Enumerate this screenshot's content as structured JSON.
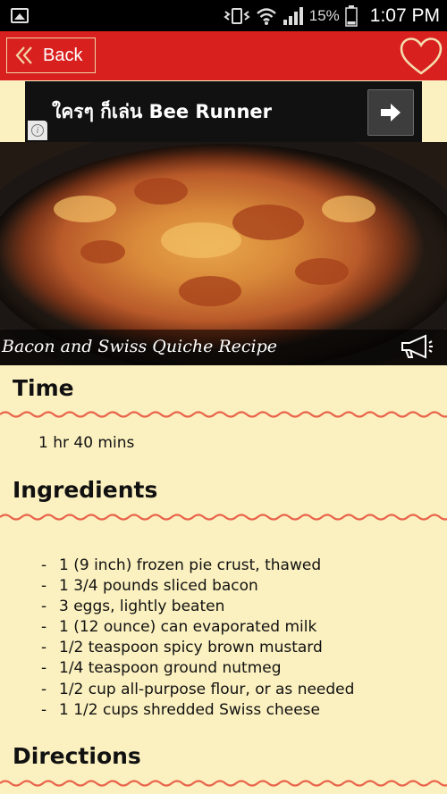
{
  "status_bar": {
    "battery_percent": "15%",
    "time": "1:07 PM",
    "icons": [
      "image-icon",
      "vibrate-icon",
      "wifi-icon",
      "signal-icon",
      "battery-icon"
    ]
  },
  "header": {
    "back_label": "Back",
    "accent_color": "#d8201e",
    "icons": [
      "double-chevron-left-icon",
      "heart-icon"
    ]
  },
  "ad": {
    "text": "ใครๆ ก็เล่น Bee Runner",
    "icons": [
      "info-icon",
      "arrow-right-icon"
    ]
  },
  "hero": {
    "title": "Bacon and Swiss Quiche Recipe",
    "icons": [
      "megaphone-icon"
    ]
  },
  "sections": {
    "time_heading": "Time",
    "time_value": "1 hr 40 mins",
    "ingredients_heading": "Ingredients",
    "directions_heading": "Directions"
  },
  "ingredients": [
    "1 (9 inch) frozen pie crust, thawed",
    "1 3/4 pounds sliced bacon",
    "3 eggs, lightly beaten",
    "1 (12 ounce) can evaporated milk",
    "1/2 teaspoon spicy brown mustard",
    "1/4 teaspoon ground nutmeg",
    "1/2 cup all-purpose flour, or as needed",
    "1 1/2 cups shredded Swiss cheese"
  ],
  "ingredient_bullet": "-"
}
